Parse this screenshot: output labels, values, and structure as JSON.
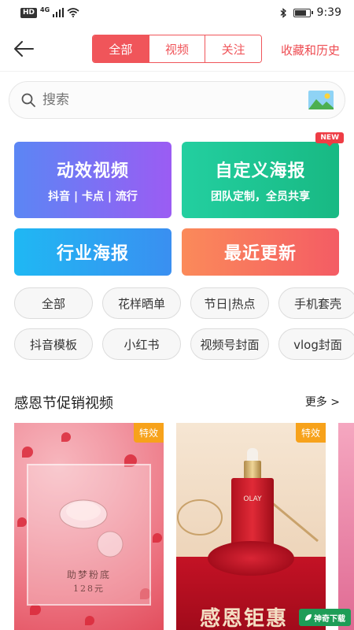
{
  "status_bar": {
    "hd": "HD",
    "network": "4G",
    "time": "9:39"
  },
  "header": {
    "tabs": [
      {
        "label": "全部",
        "active": true
      },
      {
        "label": "视频",
        "active": false
      },
      {
        "label": "关注",
        "active": false
      }
    ],
    "history_link": "收藏和历史"
  },
  "search": {
    "placeholder": "搜索"
  },
  "feature_cards": {
    "motion_video": {
      "title": "动效视频",
      "subtitle": "抖音 | 卡点 | 流行"
    },
    "custom_poster": {
      "title": "自定义海报",
      "subtitle": "团队定制，全员共享",
      "badge": "NEW"
    },
    "industry_poster": {
      "title": "行业海报"
    },
    "recent_updates": {
      "title": "最近更新"
    }
  },
  "chips": {
    "row1": [
      "全部",
      "花样晒单",
      "节日|热点",
      "手机套壳"
    ],
    "row2": [
      "抖音模板",
      "小红书",
      "视频号封面",
      "vlog封面"
    ]
  },
  "section": {
    "title": "感恩节促销视频",
    "more": "更多 >"
  },
  "thumbnails": [
    {
      "tag": "特效",
      "caption1": "助梦粉底",
      "caption2": "128元"
    },
    {
      "tag": "特效",
      "product_label": "OLAY",
      "promo": "感恩钜惠"
    }
  ],
  "watermark": "神奇下载",
  "colors": {
    "accent": "#f0555a",
    "tag": "#f7a21b"
  }
}
